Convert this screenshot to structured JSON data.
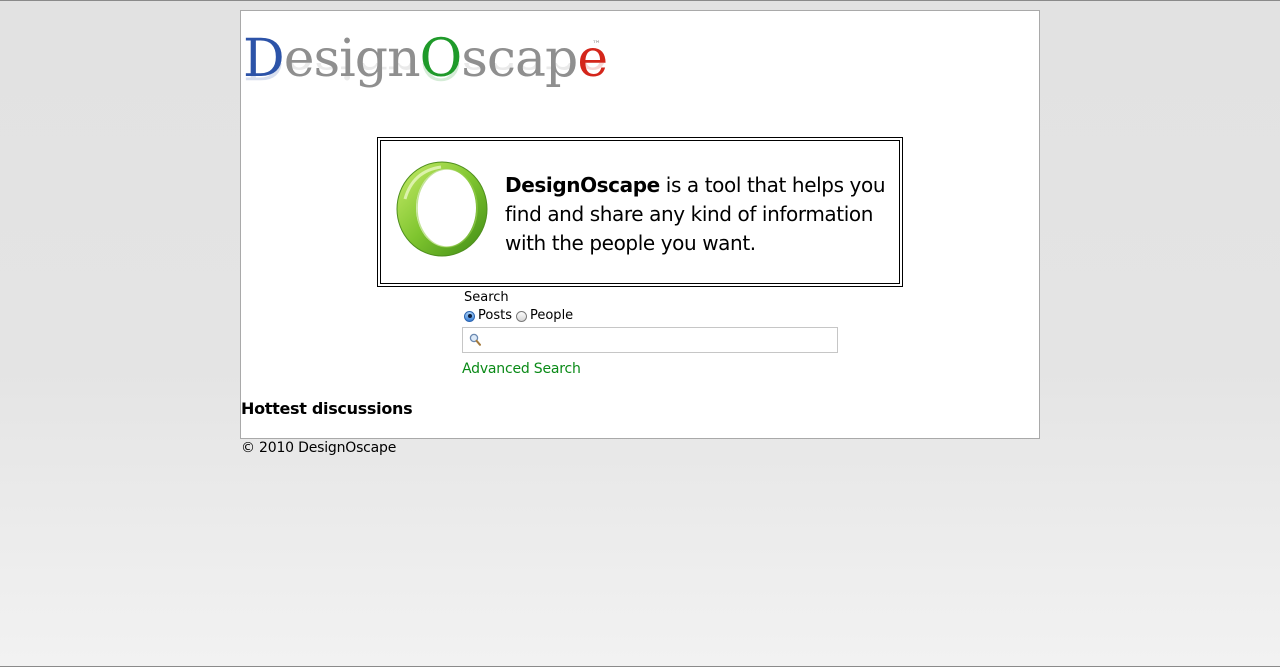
{
  "logo": {
    "part_d": "D",
    "part_esign": "esign",
    "part_o": "O",
    "part_scap": "scap",
    "part_e": "e",
    "trademark": "™"
  },
  "promo": {
    "brand": "DesignOscape",
    "text": " is a tool that helps you find and share any kind of information with the people you want."
  },
  "search": {
    "label": "Search",
    "options": [
      {
        "label": "Posts",
        "checked": true
      },
      {
        "label": "People",
        "checked": false
      }
    ],
    "value": "",
    "advanced_label": "Advanced Search"
  },
  "sections": {
    "hottest_title": "Hottest discussions"
  },
  "footer": {
    "copyright": "© 2010 DesignOscape"
  },
  "colors": {
    "logo_blue": "#2c53a8",
    "logo_gray": "#8f8f8f",
    "logo_green": "#1f9a2a",
    "logo_red": "#d4261b",
    "link_green": "#0a8a17"
  },
  "icons": {
    "promo": "green-o-ring-icon",
    "search": "magnifier-icon"
  }
}
